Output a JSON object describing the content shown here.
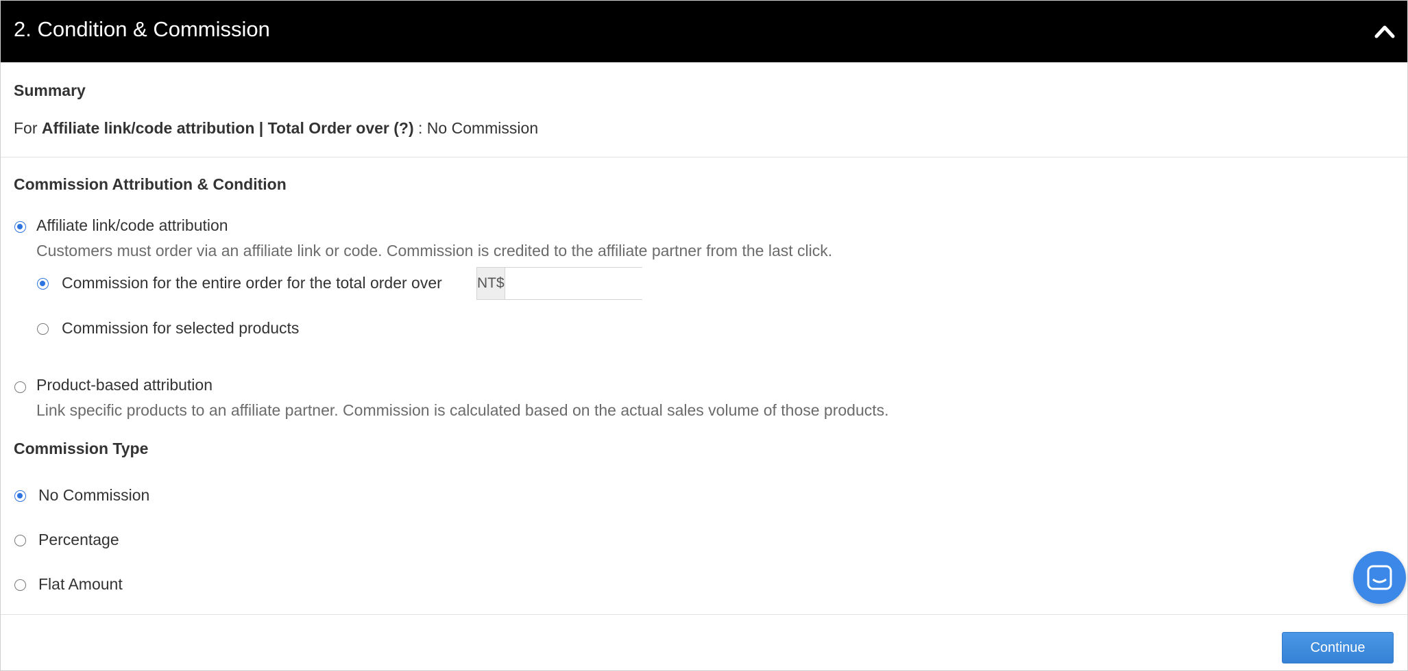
{
  "header": {
    "title": "2. Condition & Commission",
    "collapse_icon": "chevron-up-icon"
  },
  "summary": {
    "heading": "Summary",
    "prefix": "For ",
    "attribution": "Affiliate link/code attribution",
    "separator": " | ",
    "condition": "Total Order over (?)",
    "colon": " : ",
    "result": "No Commission"
  },
  "attribution_section": {
    "heading": "Commission Attribution & Condition",
    "options": [
      {
        "label": "Affiliate link/code attribution",
        "description": "Customers must order via an affiliate link or code. Commission is credited to the affiliate partner from the last click.",
        "selected": true
      },
      {
        "label": "Product-based attribution",
        "description": "Link specific products to an affiliate partner. Commission is calculated based on the actual sales volume of those products.",
        "selected": false
      }
    ],
    "sub_options": [
      {
        "label": "Commission for the entire order for the total order over",
        "selected": true
      },
      {
        "label": "Commission for selected products",
        "selected": false
      }
    ],
    "currency_prefix": "NT$",
    "order_threshold_value": "",
    "order_threshold_placeholder": ""
  },
  "commission_type": {
    "heading": "Commission Type",
    "options": [
      {
        "label": "No Commission",
        "selected": true
      },
      {
        "label": "Percentage",
        "selected": false
      },
      {
        "label": "Flat Amount",
        "selected": false
      }
    ]
  },
  "footer": {
    "continue_label": "Continue"
  },
  "chat": {
    "icon": "chat-bubble-icon"
  },
  "colors": {
    "header_bg": "#000000",
    "accent": "#2d74e0",
    "button": "#3b88e8"
  }
}
